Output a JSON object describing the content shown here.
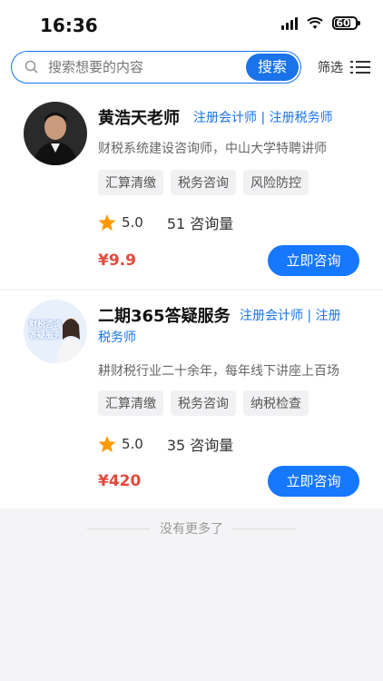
{
  "status_bar": {
    "time": "16:36",
    "battery": "60"
  },
  "search": {
    "placeholder": "搜索想要的内容",
    "button_label": "搜索",
    "filter_label": "筛选"
  },
  "colors": {
    "accent": "#1677ff",
    "price": "#e24a3b"
  },
  "consultants": [
    {
      "name": "黄浩天老师",
      "qualifications": "注册会计师 | 注册税务师",
      "description": "财税系统建设咨询师，中山大学特聘讲师",
      "tags": [
        "汇算清缴",
        "税务咨询",
        "风险防控"
      ],
      "rating": "5.0",
      "consult_count": "51 咨询量",
      "price": "¥9.9",
      "button_label": "立即咨询"
    },
    {
      "name": "二期365答疑服务",
      "qualifications_line1": "注册会计师 | 注册",
      "qualifications_line2": "税务师",
      "description": "耕财税行业二十余年，每年线下讲座上百场",
      "tags": [
        "汇算清缴",
        "税务咨询",
        "纳税检查"
      ],
      "rating": "5.0",
      "consult_count": "35 咨询量",
      "price": "¥420",
      "button_label": "立即咨询",
      "avatar_text_line1": "财税咨询",
      "avatar_text_line2": "答疑服务"
    }
  ],
  "footer": {
    "end_text": "没有更多了"
  }
}
